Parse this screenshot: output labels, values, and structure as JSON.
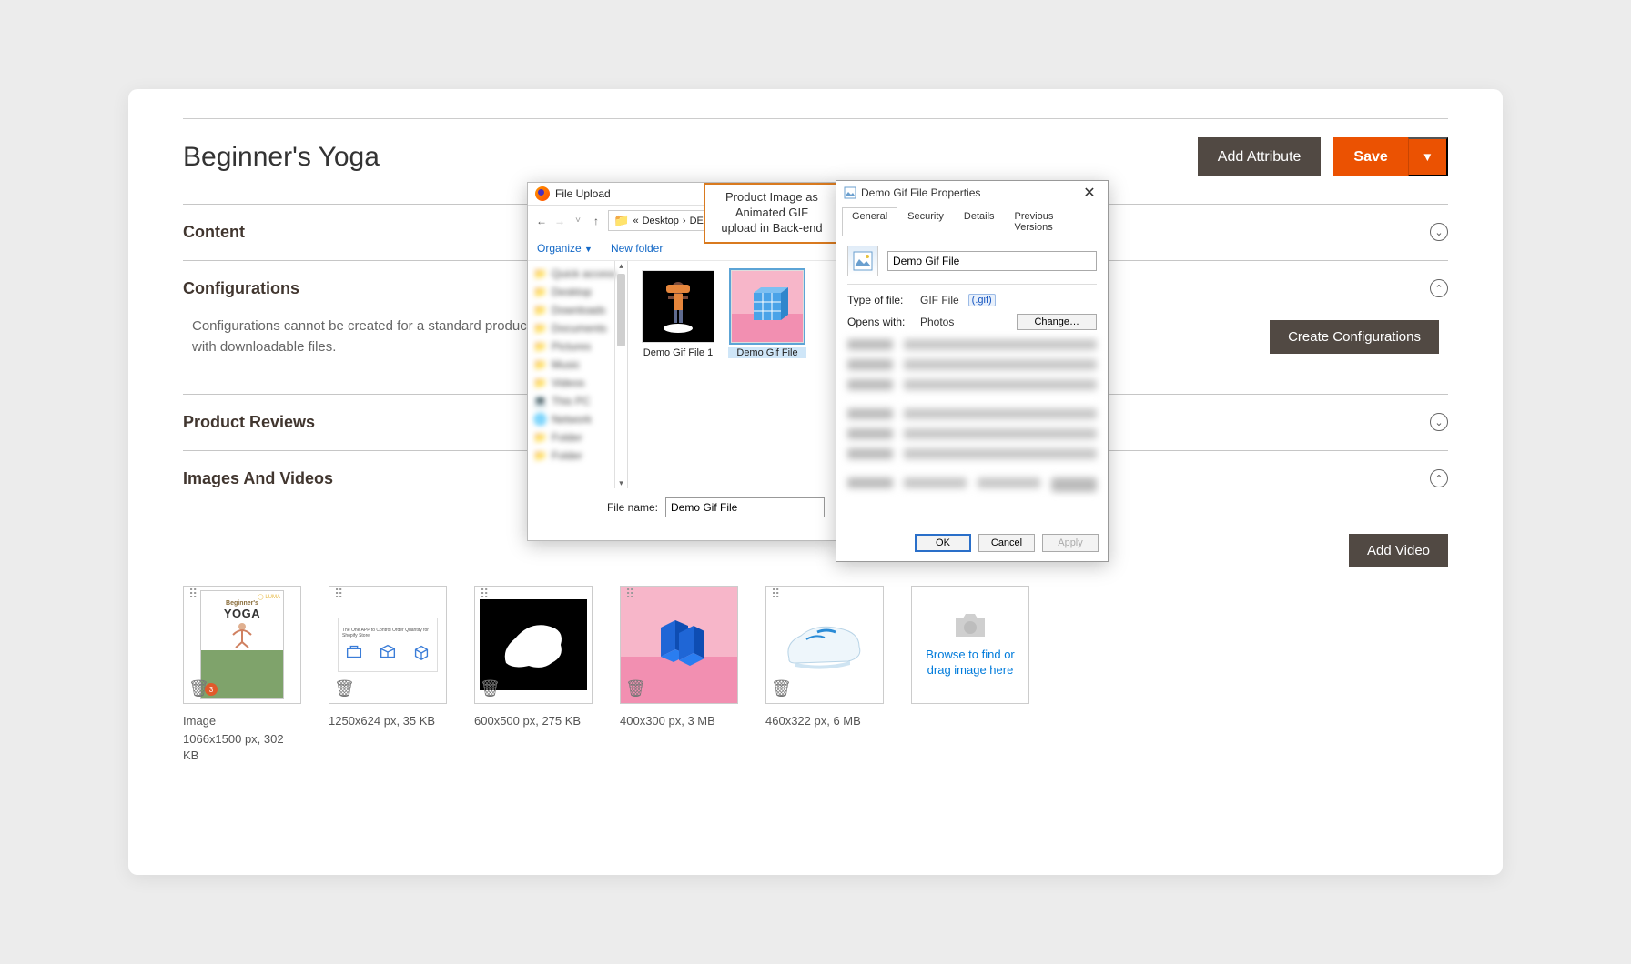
{
  "header": {
    "page_title": "Beginner's Yoga",
    "add_attribute": "Add Attribute",
    "save": "Save"
  },
  "sections": {
    "content": "Content",
    "configurations": "Configurations",
    "config_text": "Configurations cannot be created for a standard product with downloadable files.",
    "create_config_btn": "Create Configurations",
    "product_reviews": "Product Reviews",
    "images_videos": "Images And Videos",
    "add_video": "Add Video"
  },
  "thumbs": [
    {
      "role": "Image",
      "caption": "1066x1500 px, 302 KB"
    },
    {
      "caption": "1250x624 px, 35 KB"
    },
    {
      "caption": "600x500 px, 275 KB"
    },
    {
      "caption": "400x300 px, 3 MB"
    },
    {
      "caption": "460x322 px, 6 MB"
    }
  ],
  "upload_tile": "Browse to find or drag image here",
  "file_dialog": {
    "title": "File Upload",
    "path_seg1": "Desktop",
    "path_seg2": "DE",
    "organize": "Organize",
    "new_folder": "New folder",
    "files": [
      {
        "name": "Demo Gif File 1"
      },
      {
        "name": "Demo Gif File"
      }
    ],
    "filename_label": "File name:",
    "filename_value": "Demo Gif File"
  },
  "props_dialog": {
    "title": "Demo Gif File Properties",
    "tabs": [
      "General",
      "Security",
      "Details",
      "Previous Versions"
    ],
    "filename": "Demo Gif File",
    "type_label": "Type of file:",
    "type_value": "GIF File",
    "type_ext": "(.gif)",
    "opens_label": "Opens with:",
    "opens_value": "Photos",
    "change_btn": "Change…",
    "ok": "OK",
    "cancel": "Cancel",
    "apply": "Apply"
  },
  "callout": {
    "line1": "Product Image as",
    "line2": "Animated GIF",
    "line3": "upload in Back-end"
  },
  "yoga_box": {
    "t1": "Beginner's",
    "t2": "YOGA"
  }
}
